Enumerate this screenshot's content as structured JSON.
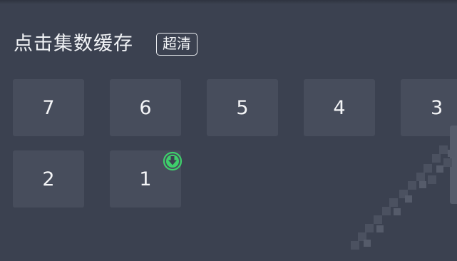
{
  "header": {
    "title": "点击集数缓存",
    "quality_label": "超清"
  },
  "episodes": [
    {
      "label": "7",
      "downloaded": false
    },
    {
      "label": "6",
      "downloaded": false
    },
    {
      "label": "5",
      "downloaded": false
    },
    {
      "label": "4",
      "downloaded": false
    },
    {
      "label": "3",
      "downloaded": false
    },
    {
      "label": "2",
      "downloaded": false
    },
    {
      "label": "1",
      "downloaded": true
    }
  ],
  "colors": {
    "background": "#3b4150",
    "tile": "#474d5c",
    "text": "#f1f3f6",
    "download_badge": "#3ecf6b"
  },
  "icons": {
    "download_badge": "download-circle-icon"
  }
}
